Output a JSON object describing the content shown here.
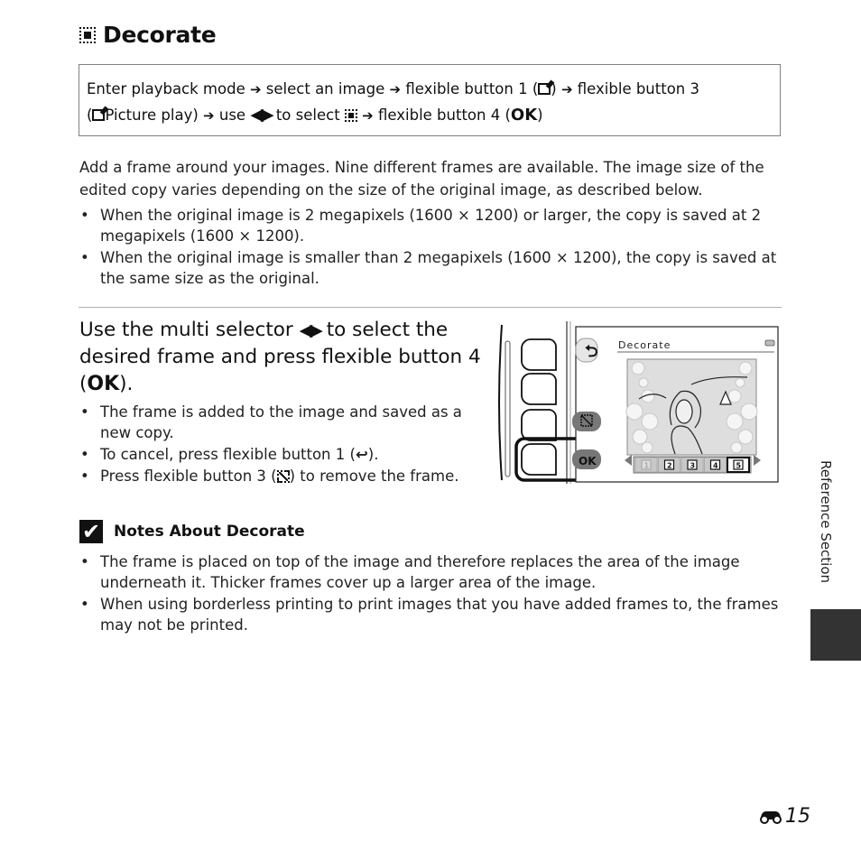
{
  "header": {
    "title": "Decorate",
    "title_icon": "decorate-frame-icon"
  },
  "path": {
    "line1": {
      "s1": "Enter playback mode",
      "arrow": "➔",
      "s2": "select an image",
      "s3": "flexible button 1 (",
      "s3_icon": "retouch-icon",
      "s3_end": ")",
      "s4": "flexible button 3"
    },
    "line2": {
      "open": "(",
      "icon": "retouch-icon",
      "s1": "Picture play)",
      "s2": "use",
      "lr": "◀▶",
      "s3": "to select",
      "s3_icon": "decorate-frame-icon",
      "s4": "flexible button 4 (",
      "ok": "OK",
      "close": ")"
    }
  },
  "intro": "Add a frame around your images. Nine different frames are available. The image size of the edited copy varies depending on the size of the original image, as described below.",
  "size_bullets": [
    "When the original image is 2 megapixels (1600 × 1200) or larger, the copy is saved at 2 megapixels (1600 × 1200).",
    "When the original image is smaller than 2 megapixels (1600 × 1200), the copy is saved at the same size as the original."
  ],
  "step": {
    "part1": "Use the multi selector",
    "lr": "◀▶",
    "part2": "to select the desired frame and press flexible button 4 (",
    "ok": "OK",
    "part3": ")."
  },
  "step_bullets": {
    "b1": "The frame is added to the image and saved as a new copy.",
    "b2_pre": "To cancel, press flexible button 1 (",
    "b2_icon": "↩",
    "b2_post": ").",
    "b3_pre": "Press flexible button 3 (",
    "b3_post": ") to remove the frame."
  },
  "camera_screen": {
    "title": "Decorate",
    "back_button": "⮌",
    "ok_button": "OK",
    "frames": [
      "1",
      "2",
      "3",
      "4",
      "5"
    ],
    "selected_frame": "5",
    "battery_icon": "battery-icon"
  },
  "notes": {
    "title": "Notes About Decorate",
    "check": "✔",
    "items": [
      "The frame is placed on top of the image and therefore replaces the area of the image underneath it. Thicker frames cover up a larger area of the image.",
      "When using borderless printing to print images that you have added frames to, the frames may not be printed."
    ]
  },
  "side": {
    "label": "Reference Section"
  },
  "footer": {
    "page_prefix_icon": "binoculars-icon",
    "page_number": "15"
  }
}
